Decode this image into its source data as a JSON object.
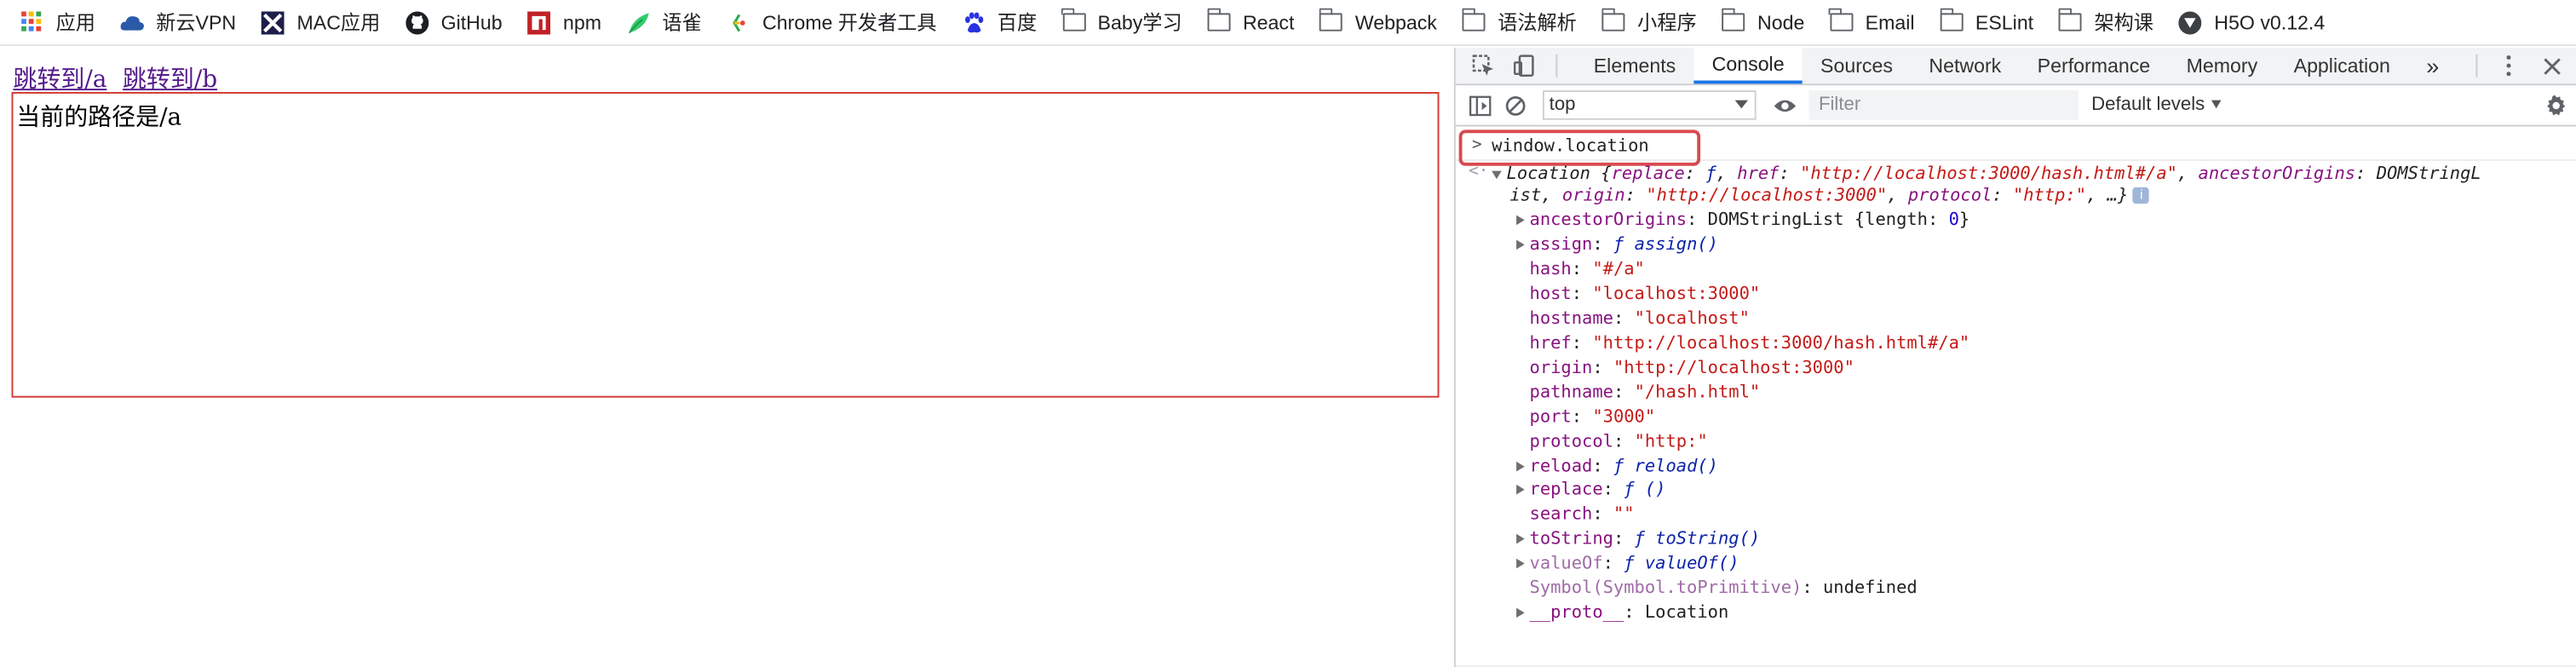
{
  "bookmarks": [
    {
      "icon": "apps-grid-icon",
      "label": "应用"
    },
    {
      "icon": "cloud-icon",
      "label": "新云VPN"
    },
    {
      "icon": "x-logo-icon",
      "label": "MAC应用"
    },
    {
      "icon": "github-icon",
      "label": "GitHub"
    },
    {
      "icon": "npm-icon",
      "label": "npm"
    },
    {
      "icon": "yuque-icon",
      "label": "语雀"
    },
    {
      "icon": "chrome-dev-icon",
      "label": "Chrome 开发者工具"
    },
    {
      "icon": "baidu-icon",
      "label": "百度"
    },
    {
      "icon": "folder-icon",
      "label": "Baby学习"
    },
    {
      "icon": "folder-icon",
      "label": "React"
    },
    {
      "icon": "folder-icon",
      "label": "Webpack"
    },
    {
      "icon": "folder-icon",
      "label": "语法解析"
    },
    {
      "icon": "folder-icon",
      "label": "小程序"
    },
    {
      "icon": "folder-icon",
      "label": "Node"
    },
    {
      "icon": "folder-icon",
      "label": "Email"
    },
    {
      "icon": "folder-icon",
      "label": "ESLint"
    },
    {
      "icon": "folder-icon",
      "label": "架构课"
    },
    {
      "icon": "h5o-icon",
      "label": "H5O v0.12.4"
    }
  ],
  "page": {
    "link_a": "跳转到/a",
    "link_b": "跳转到/b",
    "route_text": "当前的路径是/a"
  },
  "devtools": {
    "tabs": [
      "Elements",
      "Console",
      "Sources",
      "Network",
      "Performance",
      "Memory",
      "Application"
    ],
    "active_tab": "Console",
    "more_tabs": "»",
    "context": "top",
    "filter_placeholder": "Filter",
    "levels": "Default levels",
    "command": "window.location",
    "summary_line1": {
      "name": "Location",
      "open": "{",
      "replace_key": "replace",
      "replace_val": "ƒ",
      "href_key": "href",
      "href_val": "\"http://localhost:3000/hash.html#/a\"",
      "ancestor_key": "ancestorOrigins",
      "ancestor_val": "DOMStringL"
    },
    "summary_line2": {
      "wrap": "ist",
      "origin_key": "origin",
      "origin_val": "\"http://localhost:3000\"",
      "protocol_key": "protocol",
      "protocol_val": "\"http:\"",
      "tail": ", …}"
    },
    "properties": [
      {
        "key": "ancestorOrigins",
        "expandable": true,
        "value_parts": [
          [
            "plain",
            " DOMStringList "
          ],
          [
            "plain",
            "{length: "
          ],
          [
            "n",
            "0"
          ],
          [
            "plain",
            "}"
          ]
        ]
      },
      {
        "key": "assign",
        "expandable": true,
        "value_parts": [
          [
            "fn",
            "ƒ assign()"
          ]
        ]
      },
      {
        "key": "hash",
        "expandable": false,
        "value_parts": [
          [
            "s",
            "\"#/a\""
          ]
        ]
      },
      {
        "key": "host",
        "expandable": false,
        "value_parts": [
          [
            "s",
            "\"localhost:3000\""
          ]
        ]
      },
      {
        "key": "hostname",
        "expandable": false,
        "value_parts": [
          [
            "s",
            "\"localhost\""
          ]
        ]
      },
      {
        "key": "href",
        "expandable": false,
        "value_parts": [
          [
            "s",
            "\"http://localhost:3000/hash.html#/a\""
          ]
        ]
      },
      {
        "key": "origin",
        "expandable": false,
        "value_parts": [
          [
            "s",
            "\"http://localhost:3000\""
          ]
        ]
      },
      {
        "key": "pathname",
        "expandable": false,
        "value_parts": [
          [
            "s",
            "\"/hash.html\""
          ]
        ]
      },
      {
        "key": "port",
        "expandable": false,
        "value_parts": [
          [
            "s",
            "\"3000\""
          ]
        ]
      },
      {
        "key": "protocol",
        "expandable": false,
        "value_parts": [
          [
            "s",
            "\"http:\""
          ]
        ]
      },
      {
        "key": "reload",
        "expandable": true,
        "value_parts": [
          [
            "fn",
            "ƒ reload()"
          ]
        ]
      },
      {
        "key": "replace",
        "expandable": true,
        "value_parts": [
          [
            "fn",
            "ƒ ()"
          ]
        ]
      },
      {
        "key": "search",
        "expandable": false,
        "value_parts": [
          [
            "s",
            "\"\""
          ]
        ]
      },
      {
        "key": "toString",
        "expandable": true,
        "value_parts": [
          [
            "fn",
            "ƒ toString()"
          ]
        ]
      },
      {
        "key": "valueOf",
        "expandable": true,
        "value_parts": [
          [
            "fn",
            "ƒ valueOf()"
          ]
        ],
        "dim_key": true
      },
      {
        "key": "Symbol(Symbol.toPrimitive)",
        "expandable": false,
        "value_parts": [
          [
            "plain",
            "undefined"
          ]
        ],
        "dim_key": true
      },
      {
        "key": "__proto__",
        "expandable": true,
        "value_parts": [
          [
            "plain",
            "Location"
          ]
        ]
      }
    ]
  }
}
